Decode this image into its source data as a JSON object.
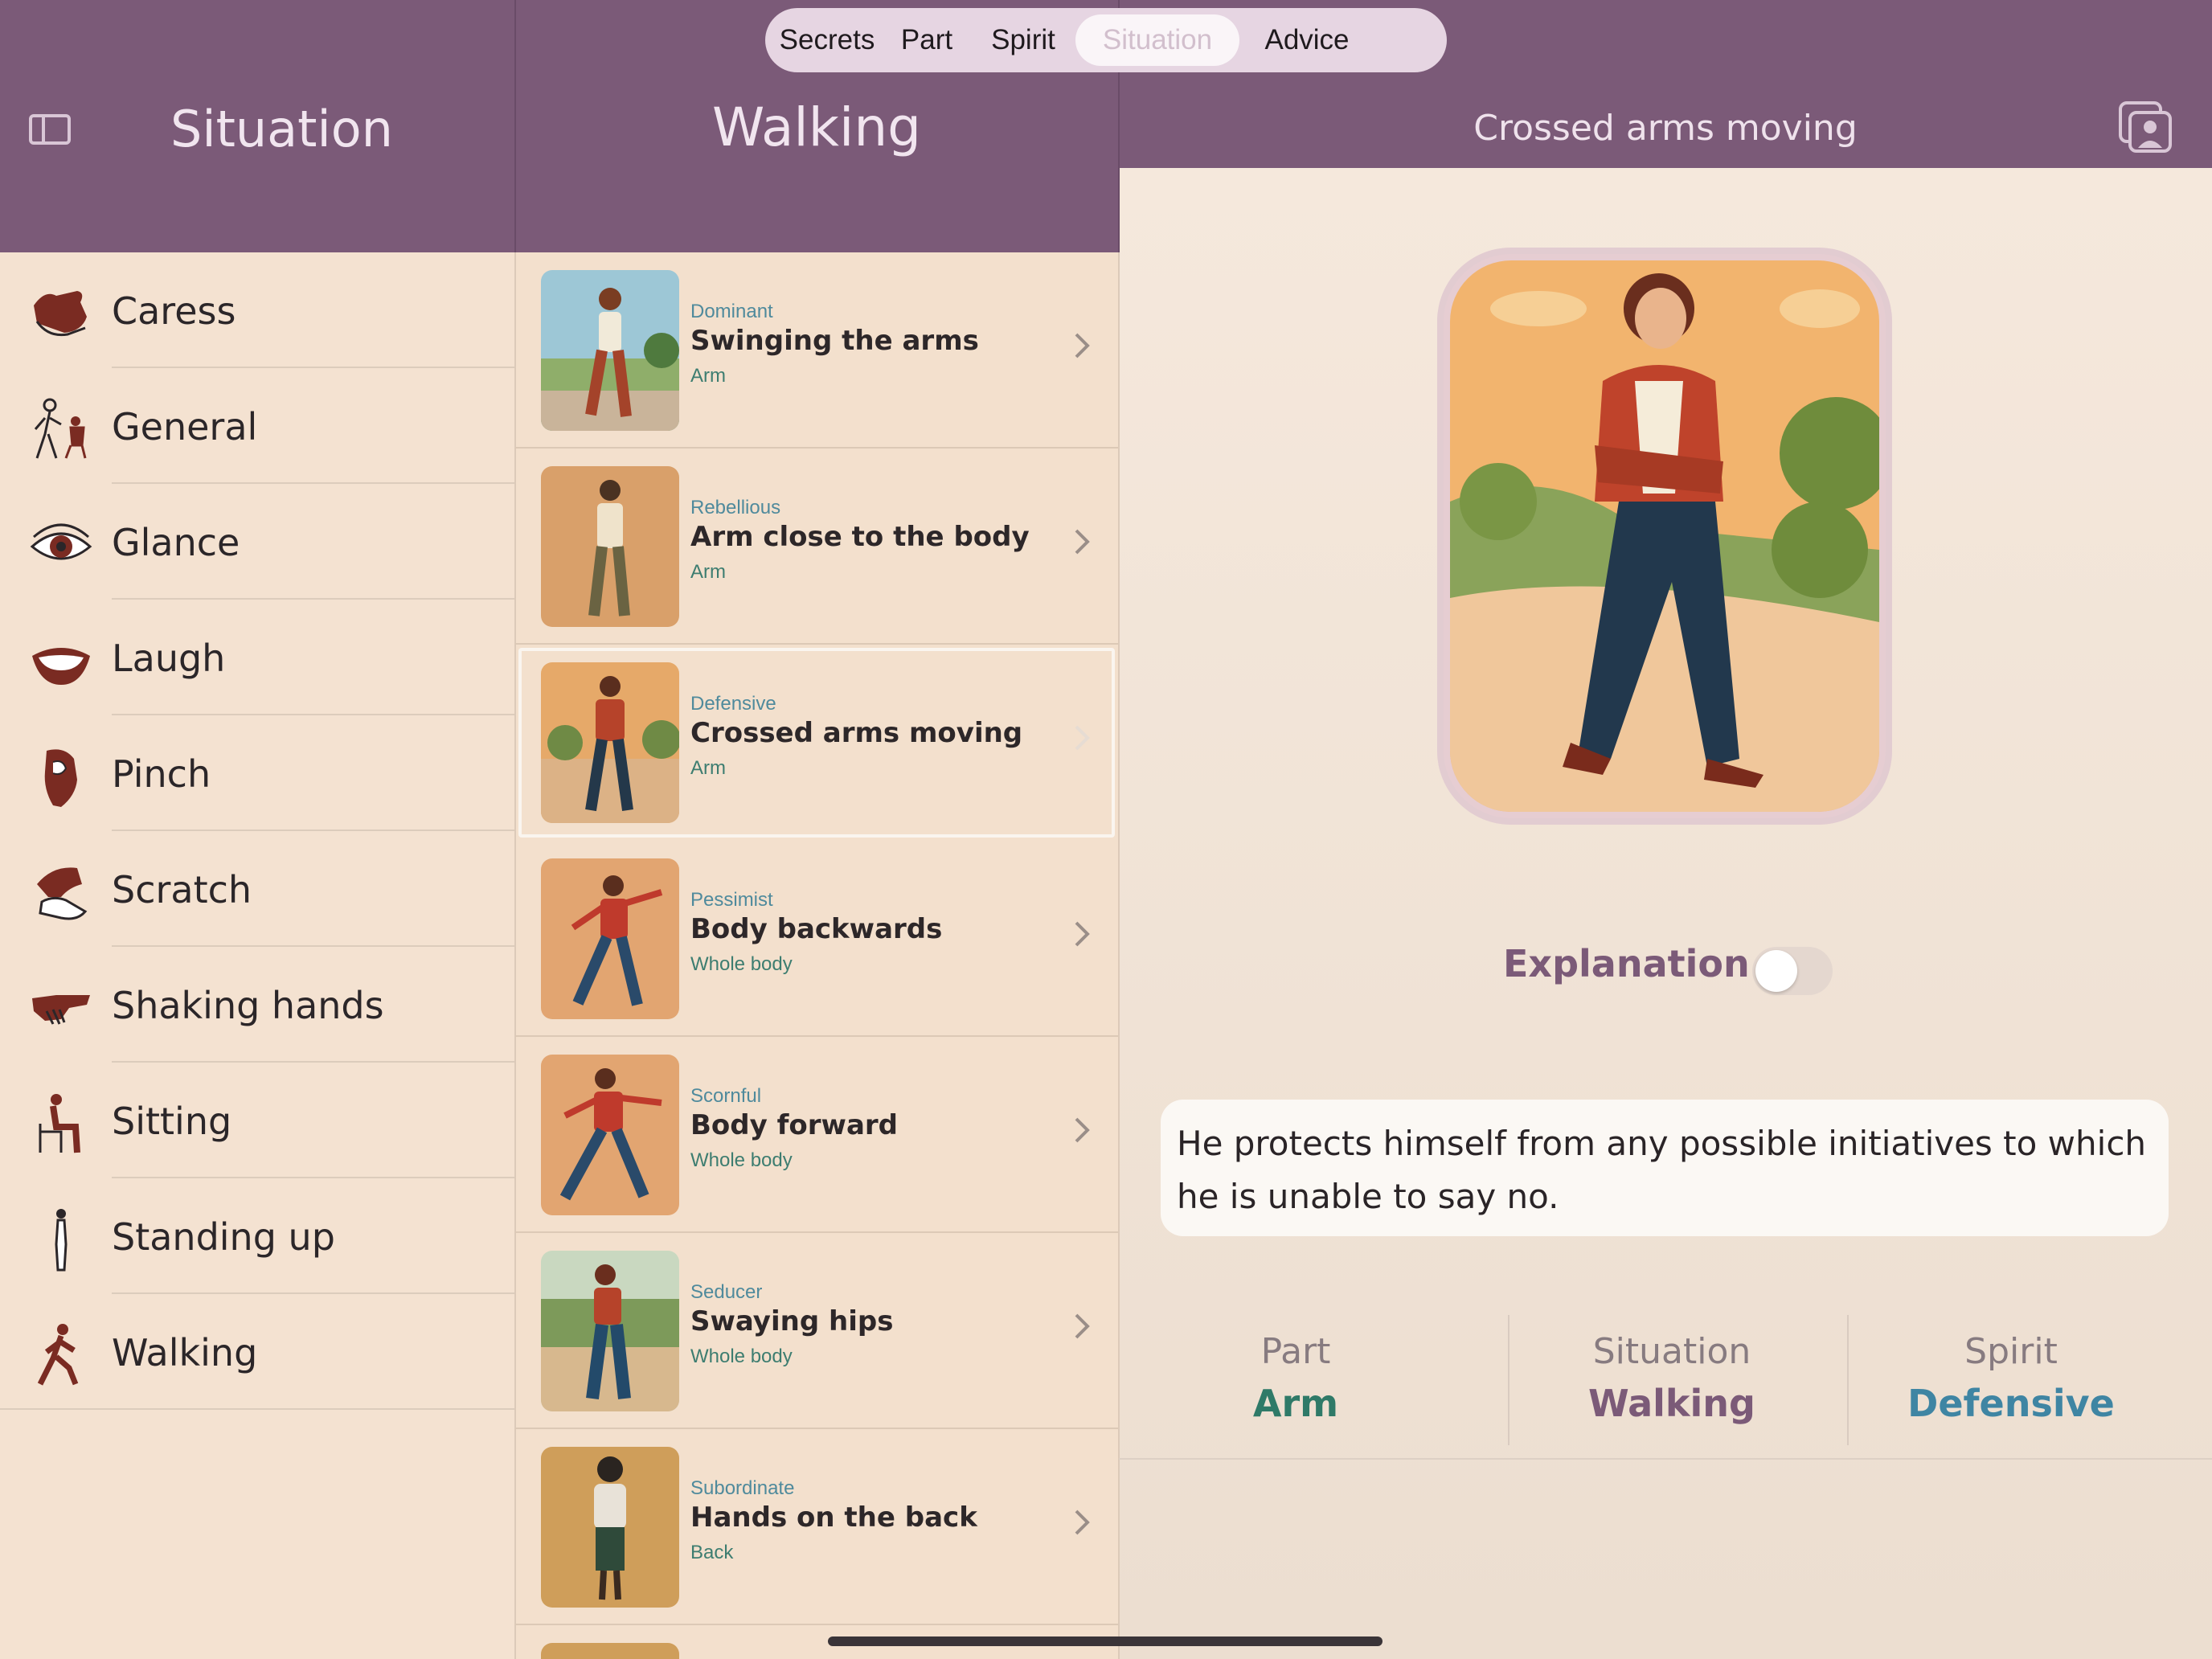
{
  "segmented": {
    "tabs": [
      "Secrets",
      "Part",
      "Spirit",
      "Situation",
      "Advice"
    ],
    "active": "Situation"
  },
  "sidebar": {
    "title": "Situation",
    "items": [
      {
        "label": "Caress",
        "icon": "caress-icon"
      },
      {
        "label": "General",
        "icon": "general-icon"
      },
      {
        "label": "Glance",
        "icon": "eye-icon"
      },
      {
        "label": "Laugh",
        "icon": "mouth-icon"
      },
      {
        "label": "Pinch",
        "icon": "pinch-icon"
      },
      {
        "label": "Scratch",
        "icon": "scratch-icon"
      },
      {
        "label": "Shaking hands",
        "icon": "handshake-icon"
      },
      {
        "label": "Sitting",
        "icon": "sitting-icon"
      },
      {
        "label": "Standing up",
        "icon": "standing-icon"
      },
      {
        "label": "Walking",
        "icon": "walking-icon"
      }
    ]
  },
  "list": {
    "title": "Walking",
    "rows": [
      {
        "category": "Dominant",
        "name": "Swinging the arms",
        "part": "Arm"
      },
      {
        "category": "Rebellious",
        "name": "Arm close to the body",
        "part": "Arm"
      },
      {
        "category": "Defensive",
        "name": "Crossed arms moving",
        "part": "Arm",
        "selected": true
      },
      {
        "category": "Pessimist",
        "name": "Body backwards",
        "part": "Whole body"
      },
      {
        "category": "Scornful",
        "name": "Body forward",
        "part": "Whole body"
      },
      {
        "category": "Seducer",
        "name": "Swaying hips",
        "part": "Whole body"
      },
      {
        "category": "Subordinate",
        "name": "Hands on the back",
        "part": "Back"
      }
    ]
  },
  "detail": {
    "title": "Crossed arms moving",
    "explanation_label": "Explanation",
    "explanation_on": false,
    "description": "He protects himself from any possible initiatives to which he is unable to say no.",
    "stats": [
      {
        "key": "Part",
        "value": "Arm",
        "color": "#2f7a68"
      },
      {
        "key": "Situation",
        "value": "Walking",
        "color": "#7b5a78"
      },
      {
        "key": "Spirit",
        "value": "Defensive",
        "color": "#3f85a3"
      }
    ]
  },
  "colors": {
    "header": "#7b5a78",
    "category_text": "#4f8a9c",
    "part_text": "#3d7d70",
    "icon_brown": "#7a2b22"
  }
}
